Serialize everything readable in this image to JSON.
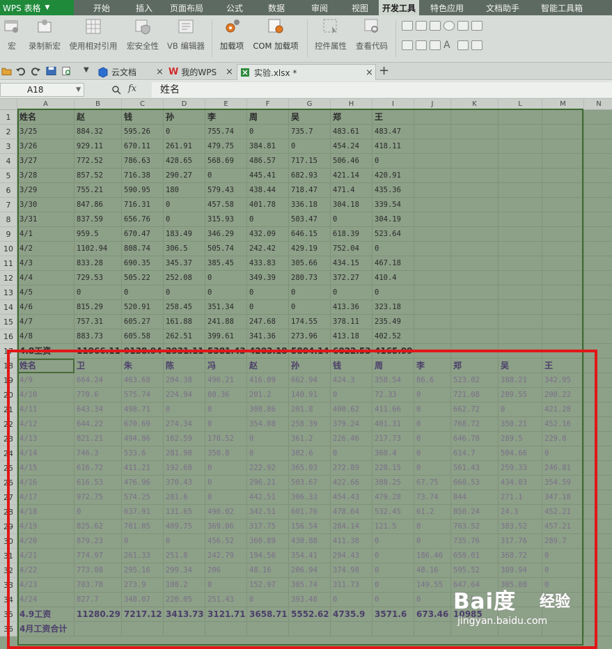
{
  "menubar": {
    "app_title": "WPS 表格",
    "tabs": [
      "开始",
      "插入",
      "页面布局",
      "公式",
      "数据",
      "审阅",
      "视图",
      "开发工具",
      "特色应用",
      "文档助手",
      "智能工具箱"
    ],
    "active_tab": "开发工具"
  },
  "ribbon": {
    "buttons": [
      "宏",
      "录制新宏",
      "使用相对引用",
      "宏安全性",
      "VB 编辑器",
      "加载项",
      "COM 加载项",
      "控件属性",
      "查看代码"
    ]
  },
  "doc_tabs": [
    "云文档",
    "我的WPS",
    "实验.xlsx *"
  ],
  "formula_bar": {
    "name_box": "A18",
    "fx": "fx",
    "value": "姓名"
  },
  "columns": [
    "A",
    "B",
    "C",
    "D",
    "E",
    "F",
    "G",
    "H",
    "I",
    "J",
    "K",
    "L",
    "M",
    "N"
  ],
  "rows": [
    {
      "n": "1",
      "bold": true,
      "cells": [
        "姓名",
        "赵",
        "钱",
        "孙",
        "李",
        "周",
        "吴",
        "郑",
        "王",
        "",
        "",
        "",
        "",
        ""
      ]
    },
    {
      "n": "2",
      "cells": [
        "3/25",
        "884.32",
        "595.26",
        "0",
        "755.74",
        "0",
        "735.7",
        "483.61",
        "483.47",
        "",
        "",
        "",
        "",
        ""
      ]
    },
    {
      "n": "3",
      "cells": [
        "3/26",
        "929.11",
        "670.11",
        "261.91",
        "479.75",
        "384.81",
        "0",
        "454.24",
        "418.11",
        "",
        "",
        "",
        "",
        ""
      ]
    },
    {
      "n": "4",
      "cells": [
        "3/27",
        "772.52",
        "786.63",
        "428.65",
        "568.69",
        "486.57",
        "717.15",
        "506.46",
        "0",
        "",
        "",
        "",
        "",
        ""
      ]
    },
    {
      "n": "5",
      "cells": [
        "3/28",
        "857.52",
        "716.38",
        "290.27",
        "0",
        "445.41",
        "682.93",
        "421.14",
        "420.91",
        "",
        "",
        "",
        "",
        ""
      ]
    },
    {
      "n": "6",
      "cells": [
        "3/29",
        "755.21",
        "590.95",
        "180",
        "579.43",
        "438.44",
        "718.47",
        "471.4",
        "435.36",
        "",
        "",
        "",
        "",
        ""
      ]
    },
    {
      "n": "7",
      "cells": [
        "3/30",
        "847.86",
        "716.31",
        "0",
        "457.58",
        "401.78",
        "336.18",
        "304.18",
        "339.54",
        "",
        "",
        "",
        "",
        ""
      ]
    },
    {
      "n": "8",
      "cells": [
        "3/31",
        "837.59",
        "656.76",
        "0",
        "315.93",
        "0",
        "503.47",
        "0",
        "304.19",
        "",
        "",
        "",
        "",
        ""
      ]
    },
    {
      "n": "9",
      "cells": [
        "4/1",
        "959.5",
        "670.47",
        "183.49",
        "346.29",
        "432.09",
        "646.15",
        "618.39",
        "523.64",
        "",
        "",
        "",
        "",
        ""
      ]
    },
    {
      "n": "10",
      "cells": [
        "4/2",
        "1102.94",
        "808.74",
        "306.5",
        "505.74",
        "242.42",
        "429.19",
        "752.04",
        "0",
        "",
        "",
        "",
        "",
        ""
      ]
    },
    {
      "n": "11",
      "cells": [
        "4/3",
        "833.28",
        "690.35",
        "345.37",
        "385.45",
        "433.83",
        "305.66",
        "434.15",
        "467.18",
        "",
        "",
        "",
        "",
        ""
      ]
    },
    {
      "n": "12",
      "cells": [
        "4/4",
        "729.53",
        "505.22",
        "252.08",
        "0",
        "349.39",
        "280.73",
        "372.27",
        "410.4",
        "",
        "",
        "",
        "",
        ""
      ]
    },
    {
      "n": "13",
      "cells": [
        "4/5",
        "0",
        "0",
        "0",
        "0",
        "0",
        "0",
        "0",
        "0",
        "",
        "",
        "",
        "",
        ""
      ]
    },
    {
      "n": "14",
      "cells": [
        "4/6",
        "815.29",
        "520.91",
        "258.45",
        "351.34",
        "0",
        "0",
        "413.36",
        "323.18",
        "",
        "",
        "",
        "",
        ""
      ]
    },
    {
      "n": "15",
      "cells": [
        "4/7",
        "757.31",
        "605.27",
        "161.88",
        "241.88",
        "247.68",
        "174.55",
        "378.11",
        "235.49",
        "",
        "",
        "",
        "",
        ""
      ]
    },
    {
      "n": "16",
      "cells": [
        "4/8",
        "883.73",
        "605.58",
        "262.51",
        "399.61",
        "341.36",
        "273.96",
        "413.18",
        "402.52",
        "",
        "",
        "",
        "",
        ""
      ]
    },
    {
      "n": "17",
      "bold": true,
      "cells": [
        "4.8工资",
        "11966.11",
        "9138.94",
        "2931.11",
        "5381.43",
        "4203.18",
        "5804.14",
        "6022.53",
        "4165.99",
        "",
        "",
        "",
        "",
        ""
      ]
    },
    {
      "n": "18",
      "bold": true,
      "sel": true,
      "cells": [
        "姓名",
        "卫",
        "朱",
        "陈",
        "冯",
        "赵",
        "孙",
        "钱",
        "周",
        "李",
        "郑",
        "吴",
        "王",
        ""
      ]
    },
    {
      "n": "19",
      "sel": true,
      "cells": [
        "4/9",
        "664.24",
        "463.68",
        "204.38",
        "496.21",
        "416.09",
        "662.94",
        "424.3",
        "358.54",
        "86.6",
        "523.02",
        "388.21",
        "342.95",
        ""
      ]
    },
    {
      "n": "20",
      "sel": true,
      "cells": [
        "4/10",
        "770.6",
        "575.74",
        "224.94",
        "80.36",
        "201.2",
        "140.91",
        "0",
        "72.33",
        "0",
        "721.08",
        "289.55",
        "200.22",
        ""
      ]
    },
    {
      "n": "21",
      "sel": true,
      "cells": [
        "4/11",
        "643.34",
        "498.71",
        "0",
        "0",
        "308.86",
        "201.8",
        "400.62",
        "411.66",
        "0",
        "662.72",
        "0",
        "421.28",
        ""
      ]
    },
    {
      "n": "22",
      "sel": true,
      "cells": [
        "4/12",
        "644.22",
        "670.69",
        "274.34",
        "0",
        "354.08",
        "258.39",
        "379.24",
        "401.31",
        "0",
        "768.72",
        "350.21",
        "452.16",
        ""
      ]
    },
    {
      "n": "23",
      "sel": true,
      "cells": [
        "4/13",
        "821.21",
        "494.86",
        "162.59",
        "178.52",
        "0",
        "361.2",
        "226.46",
        "217.73",
        "0",
        "646.78",
        "289.5",
        "229.8",
        ""
      ]
    },
    {
      "n": "24",
      "sel": true,
      "cells": [
        "4/14",
        "746.3",
        "533.6",
        "281.98",
        "350.8",
        "0",
        "302.6",
        "0",
        "360.4",
        "0",
        "614.7",
        "504.66",
        "0",
        ""
      ]
    },
    {
      "n": "25",
      "sel": true,
      "cells": [
        "4/15",
        "616.72",
        "411.21",
        "192.68",
        "0",
        "222.92",
        "365.03",
        "272.89",
        "228.15",
        "0",
        "561.43",
        "259.33",
        "246.81",
        ""
      ]
    },
    {
      "n": "26",
      "sel": true,
      "cells": [
        "4/16",
        "616.53",
        "476.96",
        "370.43",
        "0",
        "296.21",
        "503.67",
        "422.66",
        "388.25",
        "67.75",
        "660.53",
        "434.03",
        "354.59",
        ""
      ]
    },
    {
      "n": "27",
      "sel": true,
      "cells": [
        "4/17",
        "972.75",
        "574.25",
        "281.6",
        "0",
        "442.51",
        "306.33",
        "454.43",
        "479.28",
        "73.74",
        "844",
        "271.1",
        "347.18",
        ""
      ]
    },
    {
      "n": "28",
      "sel": true,
      "cells": [
        "4/18",
        "0",
        "637.91",
        "131.65",
        "490.02",
        "342.51",
        "601.76",
        "478.64",
        "532.45",
        "61.2",
        "850.24",
        "24.3",
        "452.21",
        ""
      ]
    },
    {
      "n": "29",
      "sel": true,
      "cells": [
        "4/19",
        "825.62",
        "701.05",
        "409.75",
        "369.06",
        "317.75",
        "156.54",
        "284.14",
        "121.5",
        "0",
        "763.52",
        "383.52",
        "457.21",
        ""
      ]
    },
    {
      "n": "30",
      "sel": true,
      "cells": [
        "4/20",
        "879.23",
        "0",
        "0",
        "456.52",
        "360.89",
        "430.88",
        "411.38",
        "0",
        "0",
        "735.76",
        "317.76",
        "289.7",
        ""
      ]
    },
    {
      "n": "31",
      "sel": true,
      "cells": [
        "4/21",
        "774.97",
        "261.33",
        "251.8",
        "242.79",
        "194.56",
        "354.41",
        "294.43",
        "0",
        "186.46",
        "659.01",
        "368.72",
        "0",
        ""
      ]
    },
    {
      "n": "32",
      "sel": true,
      "cells": [
        "4/22",
        "773.08",
        "295.16",
        "299.34",
        "206",
        "48.16",
        "206.94",
        "374.98",
        "0",
        "48.16",
        "595.52",
        "389.94",
        "0",
        ""
      ]
    },
    {
      "n": "33",
      "sel": true,
      "cells": [
        "4/23",
        "703.78",
        "273.9",
        "108.2",
        "0",
        "152.97",
        "305.74",
        "311.73",
        "0",
        "149.55",
        "647.64",
        "305.08",
        "0",
        ""
      ]
    },
    {
      "n": "34",
      "sel": true,
      "cells": [
        "4/24",
        "827.7",
        "348.07",
        "220.05",
        "251.43",
        "0",
        "393.48",
        "0",
        "0",
        "0",
        "734.53",
        "",
        "0",
        ""
      ]
    },
    {
      "n": "35",
      "bold": true,
      "sel": true,
      "cells": [
        "4.9工资",
        "11280.29",
        "7217.12",
        "3413.73",
        "3121.71",
        "3658.71",
        "5552.62",
        "4735.9",
        "3571.6",
        "673.46",
        "10985",
        "",
        "",
        ""
      ]
    },
    {
      "n": "36",
      "bold": true,
      "sel": true,
      "cells": [
        "4月工资合计",
        "",
        "",
        "",
        "",
        "",
        "",
        "",
        "",
        "",
        "",
        "",
        "",
        ""
      ]
    }
  ],
  "watermark": {
    "logo": "Bai度",
    "cn": "经验",
    "url": "jingyan.baidu.com"
  }
}
